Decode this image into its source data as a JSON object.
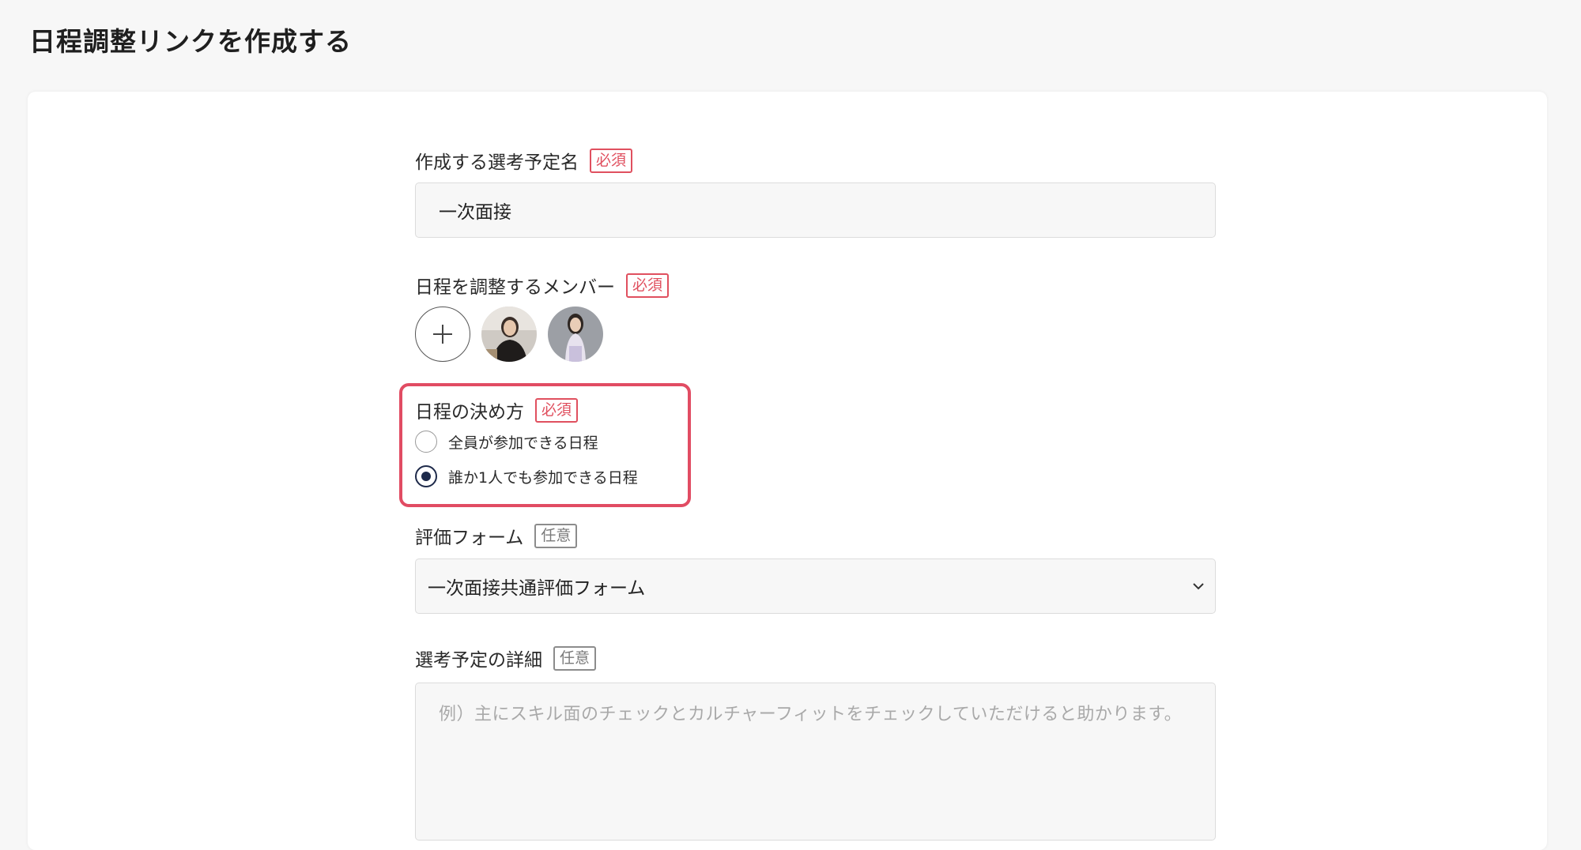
{
  "page": {
    "title": "日程調整リンクを作成する"
  },
  "form": {
    "event_name": {
      "label": "作成する選考予定名",
      "badge": "必須",
      "value": "一次面接"
    },
    "members": {
      "label": "日程を調整するメンバー",
      "badge": "必須",
      "add_icon": "plus-icon",
      "avatars": [
        "member-1",
        "member-2"
      ]
    },
    "decision_method": {
      "label": "日程の決め方",
      "badge": "必須",
      "options": [
        {
          "label": "全員が参加できる日程",
          "selected": false
        },
        {
          "label": "誰か1人でも参加できる日程",
          "selected": true
        }
      ]
    },
    "evaluation_form": {
      "label": "評価フォーム",
      "badge": "任意",
      "selected": "一次面接共通評価フォーム"
    },
    "details": {
      "label": "選考予定の詳細",
      "badge": "任意",
      "placeholder": "例）主にスキル面のチェックとカルチャーフィットをチェックしていただけると助かります。"
    }
  },
  "colors": {
    "required_badge": "#e0505f",
    "highlight": "#e14c63",
    "radio_selected": "#1e2a4a"
  }
}
